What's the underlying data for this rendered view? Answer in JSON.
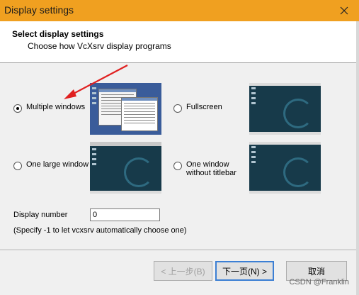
{
  "window": {
    "title": "Display settings",
    "close_icon": "close-icon"
  },
  "header": {
    "title": "Select display settings",
    "subtitle": "Choose how VcXsrv display programs"
  },
  "options": {
    "multiple_windows": {
      "label": "Multiple windows",
      "selected": true
    },
    "fullscreen": {
      "label": "Fullscreen",
      "selected": false
    },
    "one_large_window": {
      "label": "One large window",
      "selected": false
    },
    "one_window_no_titlebar": {
      "label_line1": "One window",
      "label_line2": "without titlebar",
      "selected": false
    }
  },
  "display_number": {
    "label": "Display number",
    "value": "0",
    "hint": "(Specify -1 to let vcxsrv automatically choose one)"
  },
  "buttons": {
    "back": "< 上一步(B)",
    "next": "下一页(N) >",
    "cancel": "取消"
  },
  "watermark": "CSDN @Franklin",
  "colors": {
    "titlebar": "#f0a020",
    "annotation_arrow": "#e02020"
  }
}
